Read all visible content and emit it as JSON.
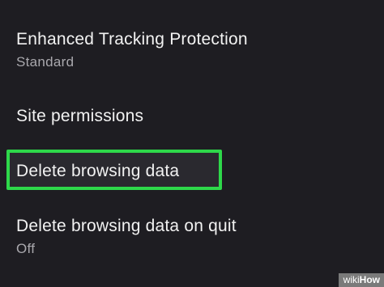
{
  "settings": {
    "items": [
      {
        "title": "Enhanced Tracking Protection",
        "subtitle": "Standard"
      },
      {
        "title": "Site permissions"
      },
      {
        "title": "Delete browsing data"
      },
      {
        "title": "Delete browsing data on quit",
        "subtitle": "Off"
      }
    ]
  },
  "highlight": {
    "color": "#2ed84a"
  },
  "watermark": {
    "wiki": "wiki",
    "how": "How"
  },
  "colors": {
    "background": "#1e1d22",
    "text_primary": "#f2f2f2",
    "text_secondary": "#a9a8ad"
  }
}
